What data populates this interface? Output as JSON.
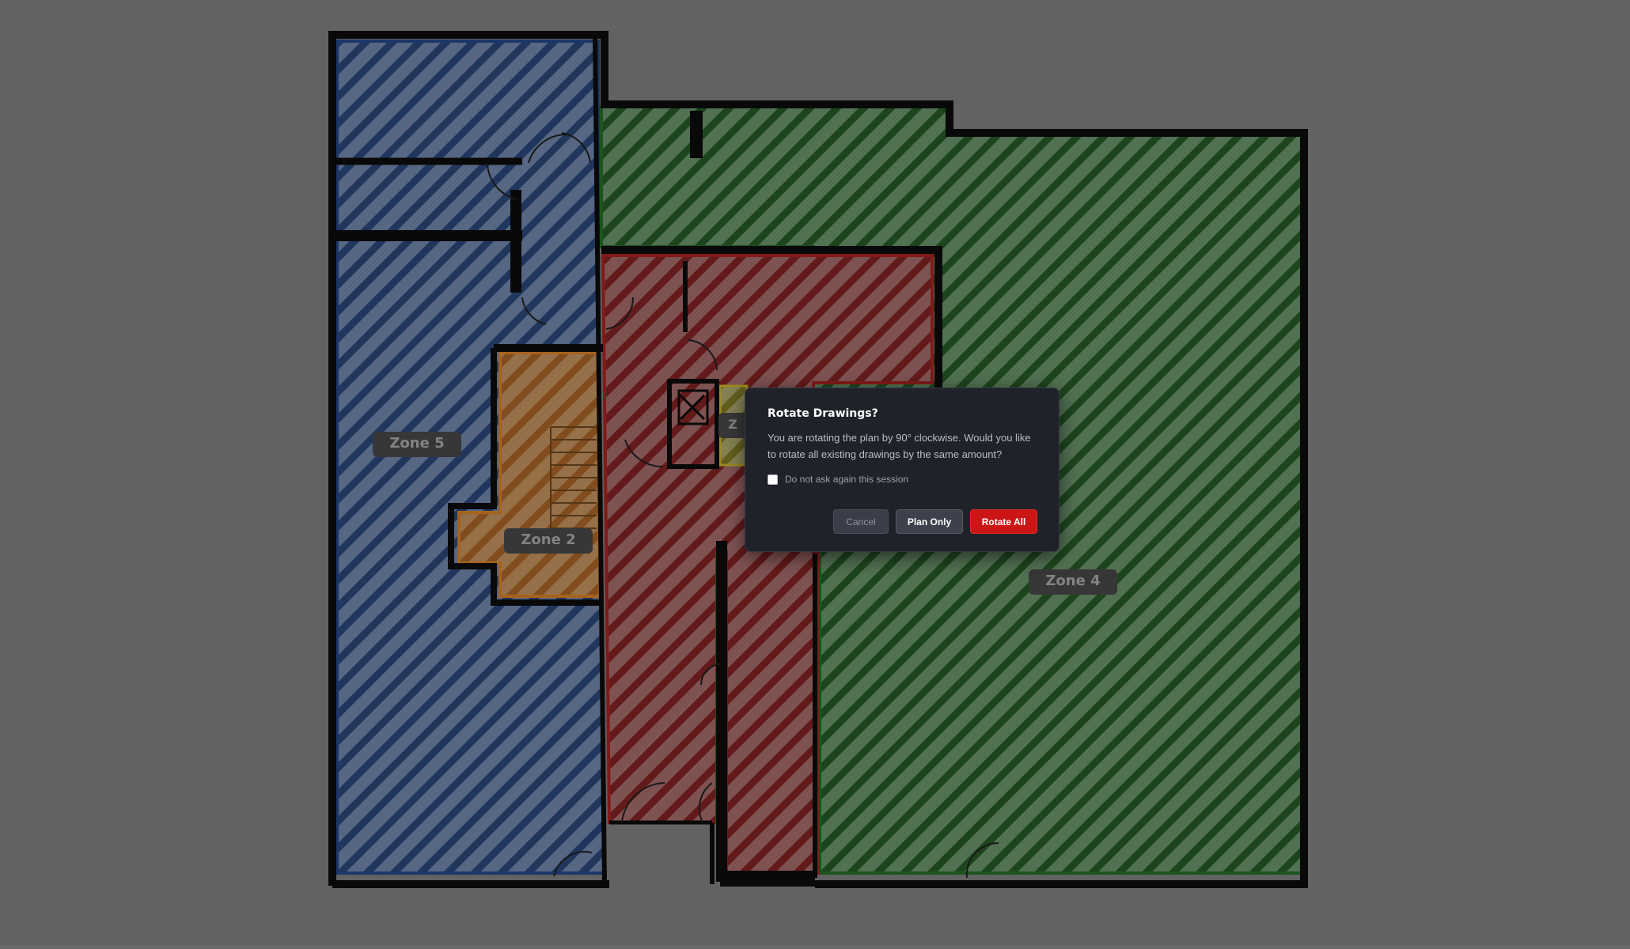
{
  "colors": {
    "background": "#696969",
    "zone_blue": "#2e4a78",
    "zone_orange": "#b9732c",
    "zone_red": "#8a2a2a",
    "zone_green": "#2f6a2f",
    "zone_yellow": "#b5a13a",
    "wall": "#0a0a0a",
    "dialog_bg": "#1f2229",
    "accent_red": "#cc1616"
  },
  "zones": [
    {
      "id": "zone-5",
      "label": "Zone 5",
      "color": "blue"
    },
    {
      "id": "zone-2",
      "label": "Zone 2",
      "color": "orange"
    },
    {
      "id": "zone-4",
      "label": "Zone 4",
      "color": "green"
    },
    {
      "id": "zone-red",
      "label": "",
      "color": "red"
    },
    {
      "id": "zone-yellow",
      "label": "Z",
      "color": "yellow"
    }
  ],
  "dialog": {
    "title": "Rotate Drawings?",
    "message": "You are rotating the plan by 90° clockwise. Would you like to rotate all existing drawings by the same amount?",
    "checkbox_label": "Do not ask again this session",
    "checkbox_checked": false,
    "buttons": {
      "cancel": "Cancel",
      "plan_only": "Plan Only",
      "rotate_all": "Rotate All"
    }
  }
}
